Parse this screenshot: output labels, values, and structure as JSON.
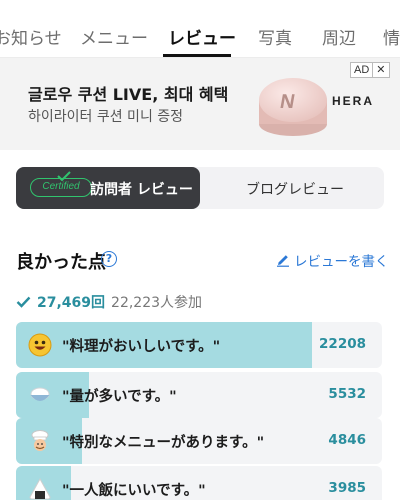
{
  "tabs": [
    {
      "label": "お知らせ",
      "active": false
    },
    {
      "label": "メニュー",
      "active": false
    },
    {
      "label": "レビュー",
      "active": true
    },
    {
      "label": "写真",
      "active": false
    },
    {
      "label": "周辺",
      "active": false
    },
    {
      "label": "情",
      "active": false
    }
  ],
  "ad": {
    "title": "글로우 쿠션 LIVE, 최대 혜택",
    "subtitle": "하이라이터 쿠션 미니 증정",
    "badge_ad": "AD",
    "badge_close": "✕",
    "brand": "HERA",
    "product_mark": "N"
  },
  "review_toggle": {
    "certified_badge": "Certified",
    "visitor_label": "訪問者 レビュー",
    "blog_label": "ブログレビュー",
    "selected": "visitor"
  },
  "section": {
    "title": "良かった点",
    "help_icon": "?",
    "write_review": "レビューを書く",
    "total_count": "27,469回",
    "participants": "22,223人参加"
  },
  "points": [
    {
      "label": "\"料理がおいしいです。\"",
      "count": "22208",
      "fill": 0.81,
      "icon": "smile-face-icon"
    },
    {
      "label": "\"量が多いです。\"",
      "count": "5532",
      "fill": 0.2,
      "icon": "rice-bowl-icon"
    },
    {
      "label": "\"特別なメニューがあります。\"",
      "count": "4846",
      "fill": 0.18,
      "icon": "chef-icon"
    },
    {
      "label": "\"一人飯にいいです。\"",
      "count": "3985",
      "fill": 0.15,
      "icon": "onigiri-icon"
    }
  ],
  "colors": {
    "accent_teal": "#2a8e9e",
    "bar_fill": "#a5dbe1",
    "link_blue": "#2b78d6",
    "certified_green": "#31c46e",
    "toggle_dark": "#3a3b3f"
  }
}
